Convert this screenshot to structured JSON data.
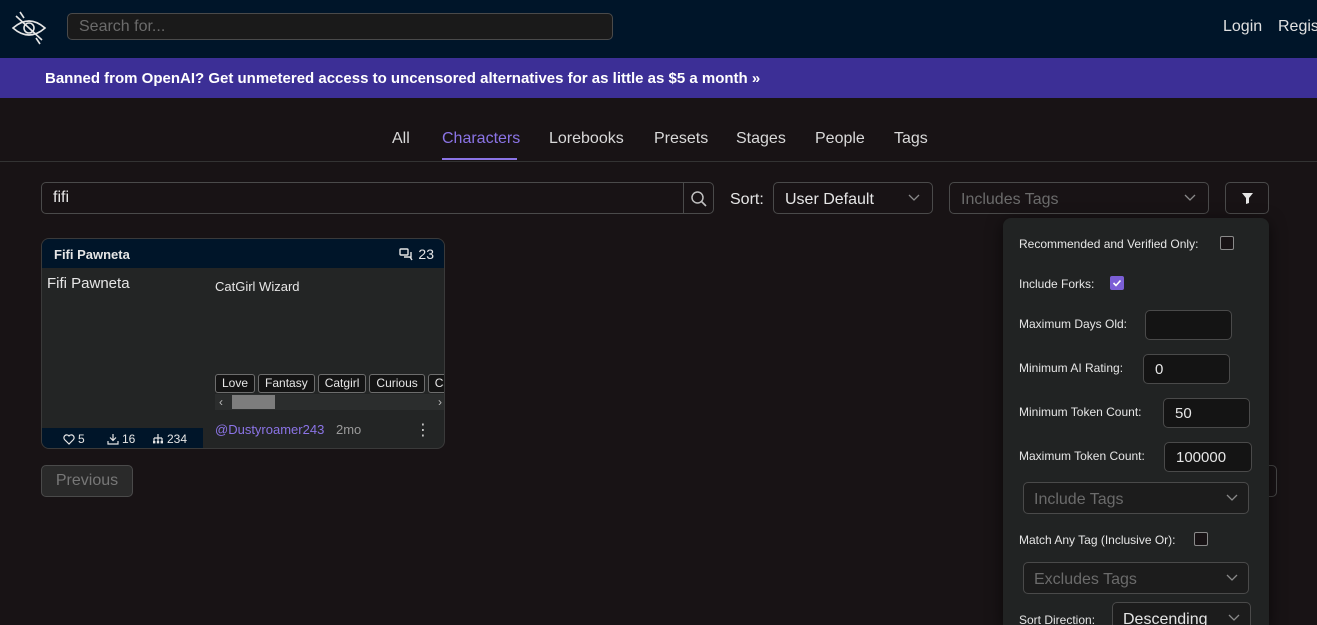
{
  "header": {
    "search_placeholder": "Search for...",
    "login": "Login",
    "register": "Register"
  },
  "banner": {
    "text": "Banned from OpenAI? Get unmetered access to uncensored alternatives for as little as $5 a month »"
  },
  "tabs": [
    {
      "label": "All",
      "active": false
    },
    {
      "label": "Characters",
      "active": true
    },
    {
      "label": "Lorebooks",
      "active": false
    },
    {
      "label": "Presets",
      "active": false
    },
    {
      "label": "Stages",
      "active": false
    },
    {
      "label": "People",
      "active": false
    },
    {
      "label": "Tags",
      "active": false
    }
  ],
  "search": {
    "value": "fifi",
    "sort_label": "Sort:",
    "sort_value": "User Default",
    "tags_placeholder": "Includes Tags"
  },
  "card": {
    "title": "Fifi Pawneta",
    "chat_count": "23",
    "name": "Fifi Pawneta",
    "tagline": "CatGirl Wizard",
    "tags": [
      "Love",
      "Fantasy",
      "Catgirl",
      "Curious",
      "Ca"
    ],
    "likes": "5",
    "downloads": "16",
    "forks": "234",
    "author": "@Dustyroamer243",
    "age": "2mo",
    "scroll_fraction": 0.25
  },
  "pagination": {
    "previous": "Previous"
  },
  "filters": {
    "recommended_label": "Recommended and Verified Only:",
    "recommended_checked": false,
    "forks_label": "Include Forks:",
    "forks_checked": true,
    "max_days_label": "Maximum Days Old:",
    "max_days_value": "",
    "min_ai_label": "Minimum AI Rating:",
    "min_ai_value": "0",
    "min_token_label": "Minimum Token Count:",
    "min_token_value": "50",
    "max_token_label": "Maximum Token Count:",
    "max_token_value": "100000",
    "include_tags_placeholder": "Include Tags",
    "match_any_label": "Match Any Tag (Inclusive Or):",
    "match_any_checked": false,
    "exclude_tags_placeholder": "Excludes Tags",
    "sort_direction_label": "Sort Direction:",
    "sort_direction_value": "Descending"
  },
  "colors": {
    "accent": "#8b74e6",
    "header_bg": "#001529",
    "banner_bg": "#3c2f96",
    "page_bg": "#181315"
  }
}
